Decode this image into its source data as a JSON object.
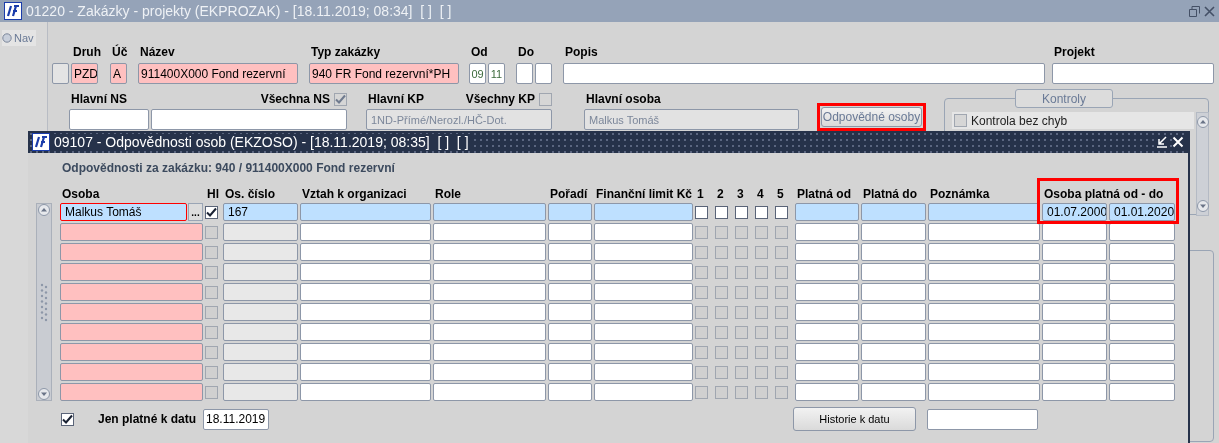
{
  "window": {
    "title": "01220 - Zakázky - projekty (EKPROZAK) - [18.11.2019; 08:34]  [ ]  [ ]"
  },
  "nav": {
    "label": "Nav",
    "selected": false
  },
  "form": {
    "row1": [
      {
        "kind": "box"
      },
      {
        "kind": "field",
        "label": "Druh",
        "value": "PZD",
        "required": true
      },
      {
        "kind": "field",
        "label": "Úč",
        "value": "A",
        "required": true
      },
      {
        "kind": "field",
        "label": "Název",
        "value": "911400X000 Fond rezervní",
        "required": true
      },
      {
        "kind": "field",
        "label": "Typ zakázky",
        "value": "940 FR Fond rezervní*PH",
        "required": true
      },
      {
        "kind": "pair",
        "label": "Od",
        "values": [
          "09",
          "11"
        ]
      },
      {
        "kind": "pair",
        "label": "Do"
      },
      {
        "kind": "field",
        "label": "Popis",
        "required": false
      },
      {
        "kind": "field",
        "label": "Projekt",
        "required": false
      }
    ],
    "ns": {
      "label": "Hlavní NS",
      "toggle": {
        "label": "Všechna NS",
        "checked": true,
        "disabled": true
      }
    },
    "kp": {
      "label": "Hlavní KP",
      "value": "1ND-Přímé/Nerozl./HČ-Dot.",
      "toggle": {
        "label": "Všechny KP",
        "checked": false,
        "disabled": true
      }
    },
    "osoba": {
      "label": "Hlavní osoba",
      "value": "Malkus Tomáš"
    },
    "responsible_button": {
      "label": "Odpovědné osoby",
      "highlighted": true
    },
    "checks_group": {
      "title": "Kontroly",
      "items": [
        {
          "label": "Kontrola bez chyb",
          "checked": false
        }
      ]
    }
  },
  "dialog": {
    "title": "09107 - Odpovědnosti osob (EKZOSO) - [18.11.2019; 08:35]  [ ]  [ ]",
    "subtitle": "Odpovědnosti za zakázku: 940 / 911400X000 Fond rezervní",
    "columns": [
      "Osoba",
      "Hl",
      "Os. číslo",
      "Vztah k organizaci",
      "Role",
      "Pořadí",
      "Finanční limit Kč",
      "1",
      "2",
      "3",
      "4",
      "5",
      "Platná od",
      "Platná do",
      "Poznámka"
    ],
    "validity_header": {
      "label": "Osoba platná od - do",
      "highlighted": true
    },
    "rows": [
      {
        "selected": true,
        "osoba": "Malkus Tomáš",
        "lookup": "...",
        "hl": true,
        "os_cislo": "167",
        "flags": [
          false,
          false,
          false,
          false,
          false
        ],
        "osoba_od": "01.07.2000",
        "osoba_do": "01.01.2020"
      },
      {
        "selected": false,
        "hl": false,
        "flags": [
          false,
          false,
          false,
          false,
          false
        ]
      },
      {
        "selected": false,
        "hl": false,
        "flags": [
          false,
          false,
          false,
          false,
          false
        ]
      },
      {
        "selected": false,
        "hl": false,
        "flags": [
          false,
          false,
          false,
          false,
          false
        ]
      },
      {
        "selected": false,
        "hl": false,
        "flags": [
          false,
          false,
          false,
          false,
          false
        ]
      },
      {
        "selected": false,
        "hl": false,
        "flags": [
          false,
          false,
          false,
          false,
          false
        ]
      },
      {
        "selected": false,
        "hl": false,
        "flags": [
          false,
          false,
          false,
          false,
          false
        ]
      },
      {
        "selected": false,
        "hl": false,
        "flags": [
          false,
          false,
          false,
          false,
          false
        ]
      },
      {
        "selected": false,
        "hl": false,
        "flags": [
          false,
          false,
          false,
          false,
          false
        ]
      },
      {
        "selected": false,
        "hl": false,
        "flags": [
          false,
          false,
          false,
          false,
          false
        ]
      }
    ],
    "filter": {
      "label": "Jen platné k datu",
      "checked": true,
      "date": "18.11.2019"
    },
    "history_button": "Historie k datu"
  }
}
